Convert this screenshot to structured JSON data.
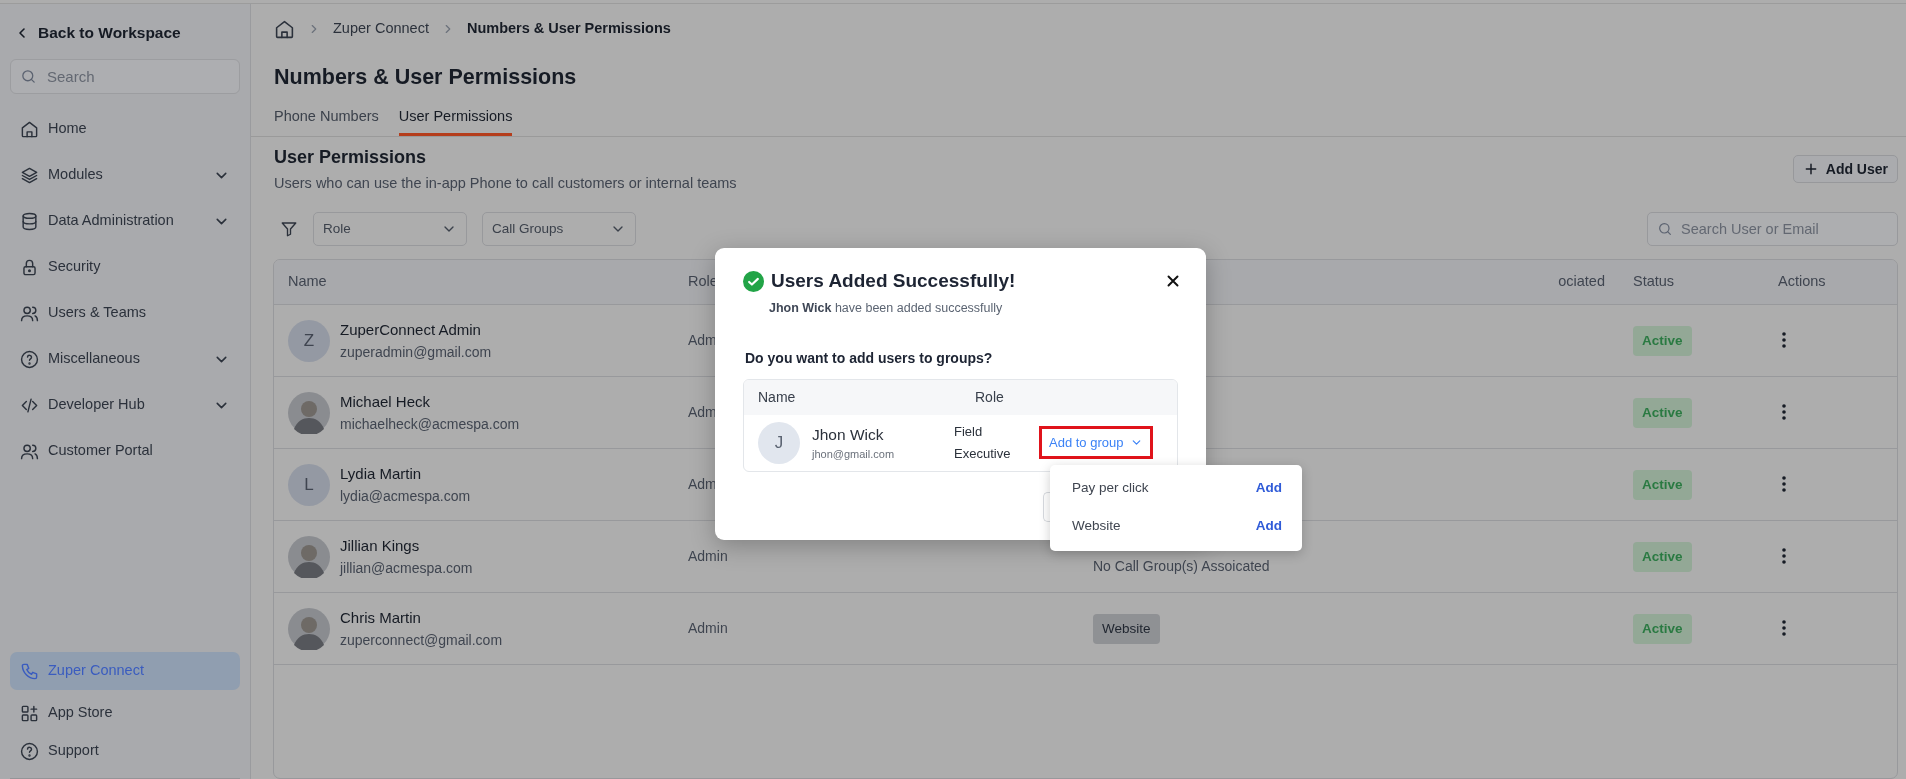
{
  "sidebar": {
    "back": "Back to Workspace",
    "search": {
      "placeholder": "Search"
    },
    "items": [
      {
        "label": "Home",
        "expandable": false,
        "selected": false
      },
      {
        "label": "Modules",
        "expandable": true,
        "selected": false
      },
      {
        "label": "Data Administration",
        "expandable": true,
        "selected": false
      },
      {
        "label": "Security",
        "expandable": false,
        "selected": false
      },
      {
        "label": "Users & Teams",
        "expandable": false,
        "selected": false
      },
      {
        "label": "Miscellaneous",
        "expandable": true,
        "selected": false
      },
      {
        "label": "Developer Hub",
        "expandable": true,
        "selected": false
      },
      {
        "label": "Customer Portal",
        "expandable": false,
        "selected": false
      }
    ],
    "bottom_items": [
      {
        "label": "Zuper Connect",
        "selected": true
      },
      {
        "label": "App Store",
        "selected": false
      },
      {
        "label": "Support",
        "selected": false
      }
    ]
  },
  "breadcrumb": [
    "Zuper Connect",
    "Numbers & User Permissions"
  ],
  "title": "Numbers & User Permissions",
  "tabs": [
    {
      "label": "Phone Numbers",
      "selected": false
    },
    {
      "label": "User Permissions",
      "selected": true
    }
  ],
  "section": {
    "title": "User Permissions",
    "subtitle": "Users who can use the in-app Phone to call customers or internal teams",
    "add_button": "Add User"
  },
  "filters": [
    {
      "label": "Role"
    },
    {
      "label": "Call Groups"
    }
  ],
  "search": {
    "placeholder": "Search User or Email"
  },
  "table": {
    "columns": [
      "Name",
      "Role",
      "ociated",
      "Status",
      "Actions"
    ],
    "rows": [
      {
        "avatar": {
          "kind": "initial",
          "letter": "Z"
        },
        "name": "ZuperConnect Admin",
        "email": "zuperadmin@gmail.com",
        "role": "Adm",
        "status": "Active"
      },
      {
        "name": "Michael Heck",
        "email": "michaelheck@acmespa.com",
        "role": "Adm",
        "status": "Active"
      },
      {
        "avatar": {
          "kind": "initial",
          "letter": "L"
        },
        "name": "Lydia Martin",
        "email": "lydia@acmespa.com",
        "role": "Adm",
        "status": "Active"
      },
      {
        "name": "Jillian Kings",
        "email": "jillian@acmespa.com",
        "role": "Admin",
        "call_groups": {
          "kind": "text",
          "text": "No Call Group(s) Assoicated"
        },
        "status": "Active"
      },
      {
        "name": "Chris Martin",
        "email": "zuperconnect@gmail.com",
        "role": "Admin",
        "call_groups": {
          "kind": "tag",
          "text": "Website"
        },
        "status": "Active"
      }
    ]
  },
  "modal": {
    "title": "Users Added Successfully!",
    "message": "**Jhon Wick** have been added successfully",
    "question": "Do you want to add users to groups?",
    "columns": [
      "Name",
      "Role"
    ],
    "user": {
      "initial": "J",
      "name": "Jhon Wick",
      "email": "jhon@gmail.com",
      "role": [
        "Field",
        "Executive"
      ],
      "action": "Add to group",
      "highlighted": true
    },
    "dropdown": [
      {
        "label": "Pay per click",
        "action": "Add"
      },
      {
        "label": "Website",
        "action": "Add"
      }
    ]
  }
}
